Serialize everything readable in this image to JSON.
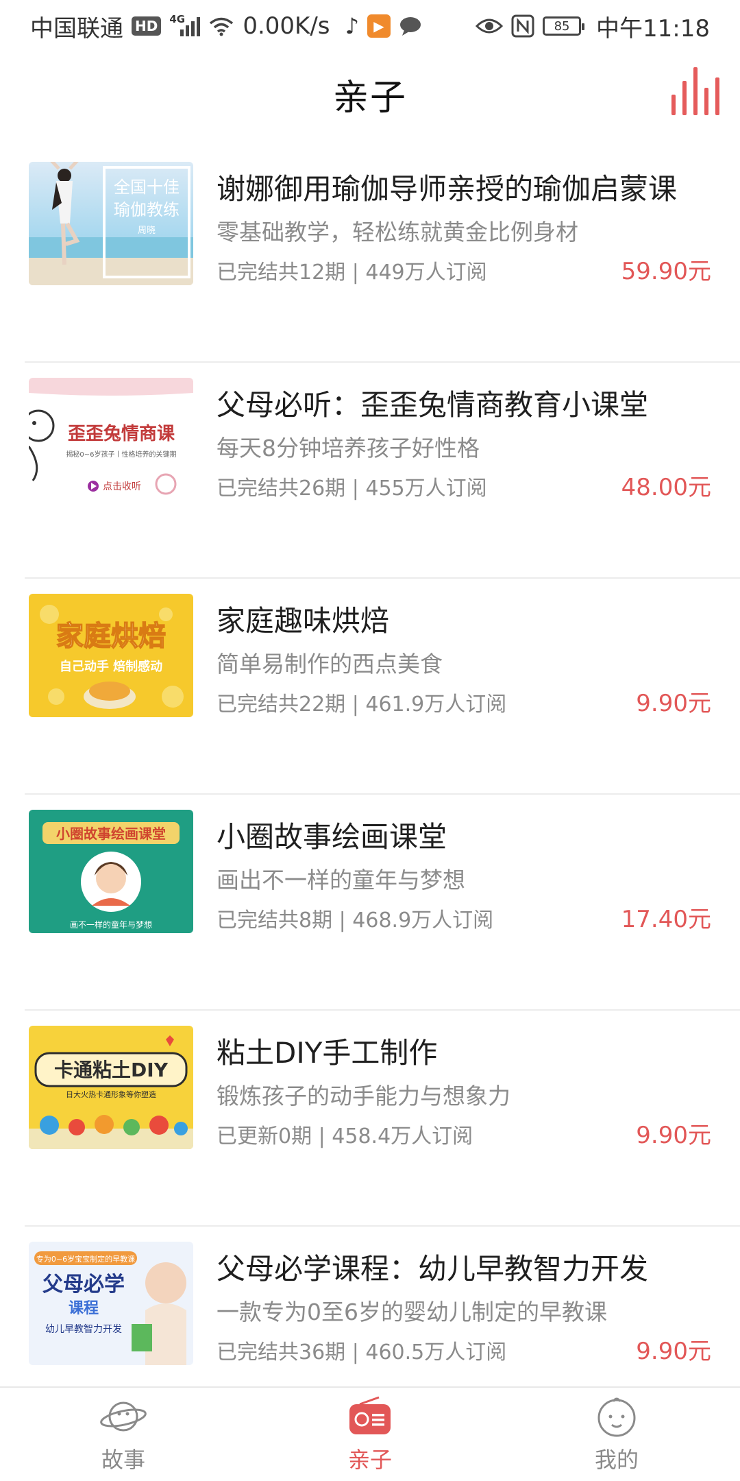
{
  "status_bar": {
    "carrier": "中国联通",
    "hd": "HD",
    "network_type": "4G",
    "speed": "0.00K/s",
    "battery_level": "85",
    "time": "中午11:18",
    "icons": [
      "hd-badge",
      "signal-icon",
      "wifi-icon",
      "music-note-icon",
      "video-app-icon",
      "chat-bubble-icon",
      "eye-icon",
      "nfc-icon",
      "battery-icon"
    ]
  },
  "header": {
    "title": "亲子",
    "chart_icon": "bar-chart-icon",
    "accent_color": "#e55b5b"
  },
  "courses": [
    {
      "title": "谢娜御用瑜伽导师亲授的瑜伽启蒙课",
      "subtitle": "零基础教学，轻松练就黄金比例身材",
      "meta": "已完结共12期 | 449万人订阅",
      "price": "59.90元",
      "thumb": {
        "line1": "全国十佳",
        "line2": "瑜伽教练",
        "name": "周晓"
      }
    },
    {
      "title": "父母必听：歪歪兔情商教育小课堂",
      "subtitle": "每天8分钟培养孩子好性格",
      "meta": "已完结共26期 | 455万人订阅",
      "price": "48.00元",
      "thumb": {
        "line1": "歪歪兔情商课",
        "line2": "揭秘0~6岁孩子丨性格培养的关键期",
        "button": "点击收听"
      }
    },
    {
      "title": "家庭趣味烘焙",
      "subtitle": "简单易制作的西点美食",
      "meta": "已完结共22期 | 461.9万人订阅",
      "price": "9.90元",
      "thumb": {
        "line1": "家庭烘焙",
        "line2": "自己动手 焙制感动"
      }
    },
    {
      "title": "小圈故事绘画课堂",
      "subtitle": "画出不一样的童年与梦想",
      "meta": "已完结共8期 | 468.9万人订阅",
      "price": "17.40元",
      "thumb": {
        "line1": "小圈故事绘画课堂",
        "line2": "画不一样的童年与梦想"
      }
    },
    {
      "title": "粘土DIY手工制作",
      "subtitle": "锻炼孩子的动手能力与想象力",
      "meta": "已更新0期 | 458.4万人订阅",
      "price": "9.90元",
      "thumb": {
        "line1": "卡通粘土DIY",
        "line2": "日大火热卡通形象等你塑造"
      }
    },
    {
      "title": "父母必学课程：幼儿早教智力开发",
      "subtitle": "一款专为0至6岁的婴幼儿制定的早教课",
      "meta": "已完结共36期 | 460.5万人订阅",
      "price": "9.90元",
      "thumb": {
        "line1": "父母必学",
        "line2": "课程",
        "line3": "幼儿早教智力开发",
        "tag": "专为0~6岁宝宝制定的早教课"
      }
    }
  ],
  "bottom_nav": {
    "items": [
      {
        "label": "故事",
        "icon": "planet-icon",
        "active": false
      },
      {
        "label": "亲子",
        "icon": "radio-icon",
        "active": true
      },
      {
        "label": "我的",
        "icon": "baby-face-icon",
        "active": false
      }
    ],
    "active_color": "#e25757"
  }
}
